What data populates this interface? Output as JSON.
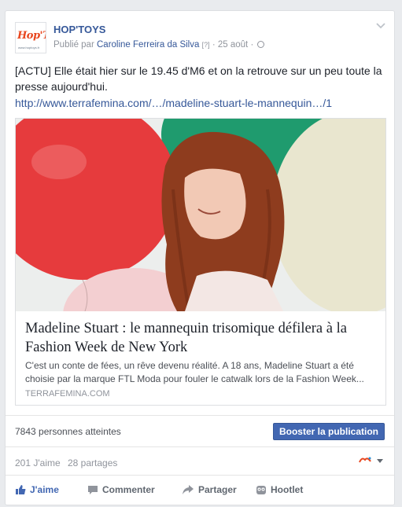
{
  "post": {
    "page_name": "HOP'TOYS",
    "logo_text": "Hop'Toys",
    "logo_url": "www.hoptoys.fr",
    "published_prefix": "Publié par",
    "author": "Caroline Ferreira da Silva",
    "help_mark": "[?]",
    "separator": "·",
    "date": "25 août",
    "separator2": "·",
    "text": "[ACTU] Elle était hier sur le 19.45 d'M6 et on la retrouve sur un peu toute la presse aujourd'hui.",
    "link": "http://www.terrafemina.com/…/madeline-stuart-le-mannequin…/1"
  },
  "attachment": {
    "title": "Madeline Stuart : le mannequin trisomique défilera à la Fashion Week de New York",
    "description": "C'est un conte de fées, un rêve devenu réalité. A 18 ans, Madeline Stuart a été choisie par la marque FTL Moda pour fouler le catwalk lors de la Fashion Week...",
    "domain": "TERRAFEMINA.COM"
  },
  "reach": {
    "text": "7843 personnes atteintes",
    "boost_label": "Booster la publication"
  },
  "stats": {
    "likes": "201 J'aime",
    "shares": "28 partages"
  },
  "actions": {
    "like": "J'aime",
    "comment": "Commenter",
    "share": "Partager",
    "hootlet": "Hootlet"
  },
  "colors": {
    "link_blue": "#365899",
    "boost_blue": "#4267b2",
    "muted_gray": "#90949c"
  },
  "icons": [
    "globe-icon",
    "chevron-down-icon",
    "thumbs-up-icon",
    "comment-icon",
    "share-arrow-icon",
    "owl-icon",
    "caret-down-icon"
  ]
}
